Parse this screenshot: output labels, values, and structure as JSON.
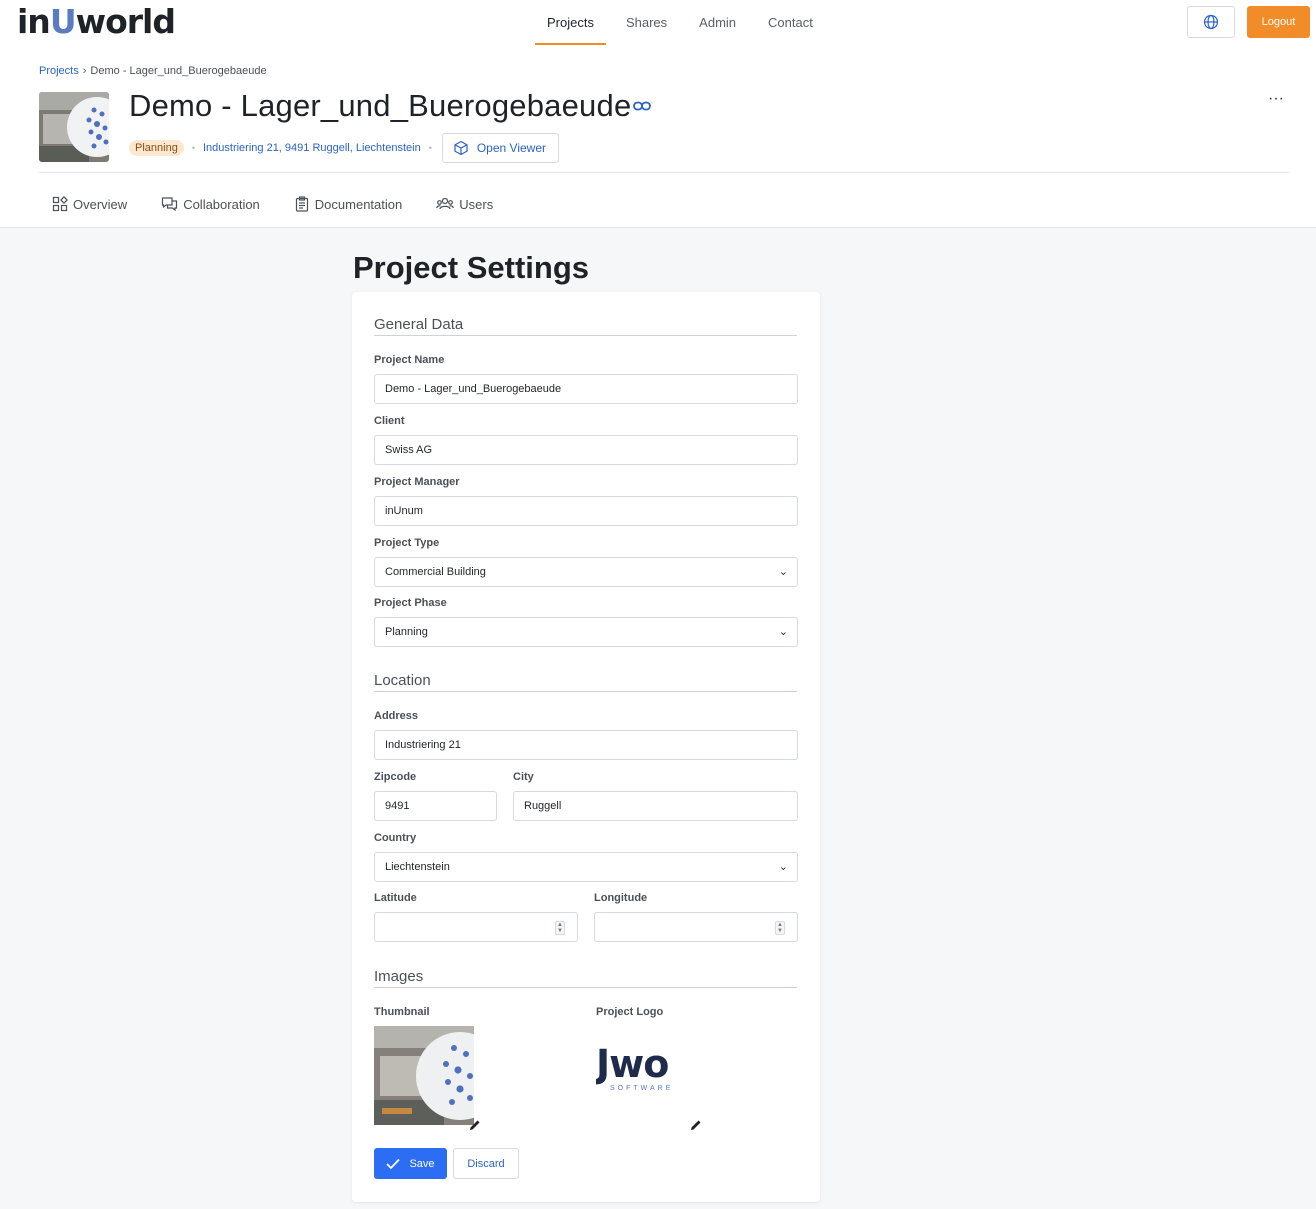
{
  "brand": {
    "logo_prefix": "in",
    "logo_u": "U",
    "logo_suffix": "world"
  },
  "nav": {
    "items": [
      {
        "label": "Projects",
        "active": true
      },
      {
        "label": "Shares"
      },
      {
        "label": "Admin"
      },
      {
        "label": "Contact"
      }
    ]
  },
  "header_actions": {
    "language_icon": "globe-icon",
    "logout_label": "Logout"
  },
  "breadcrumb": {
    "root": "Projects",
    "separator": "›",
    "current": "Demo - Lager_und_Buerogebaeude"
  },
  "project": {
    "title": "Demo - Lager_und_Buerogebaeude",
    "phase_badge": "Planning",
    "address": "Industriering 21, 9491 Ruggell, Liechtenstein",
    "open_viewer_label": "Open Viewer",
    "more_menu": "···"
  },
  "subtabs": [
    {
      "label": "Overview",
      "icon": "overview-icon"
    },
    {
      "label": "Collaboration",
      "icon": "chat-icon"
    },
    {
      "label": "Documentation",
      "icon": "clipboard-icon"
    },
    {
      "label": "Users",
      "icon": "users-icon"
    }
  ],
  "settings": {
    "heading": "Project Settings",
    "general": {
      "title": "General Data",
      "project_name_label": "Project Name",
      "project_name_value": "Demo - Lager_und_Buerogebaeude",
      "client_label": "Client",
      "client_value": "Swiss AG",
      "manager_label": "Project Manager",
      "manager_value": "inUnum",
      "type_label": "Project Type",
      "type_value": "Commercial Building",
      "phase_label": "Project Phase",
      "phase_value": "Planning"
    },
    "location": {
      "title": "Location",
      "address_label": "Address",
      "address_value": "Industriering 21",
      "zip_label": "Zipcode",
      "zip_value": "9491",
      "city_label": "City",
      "city_value": "Ruggell",
      "country_label": "Country",
      "country_value": "Liechtenstein",
      "lat_label": "Latitude",
      "lat_value": "",
      "lon_label": "Longitude",
      "lon_value": ""
    },
    "images": {
      "title": "Images",
      "thumbnail_label": "Thumbnail",
      "logo_label": "Project Logo",
      "logo_text": "Jwo",
      "logo_subtext": "SOFTWARE"
    },
    "save_label": "Save",
    "discard_label": "Discard"
  },
  "colors": {
    "accent": "#f28c28",
    "link": "#2a63c7",
    "primary": "#2b6ef3",
    "brand_u": "#5b7bc0"
  }
}
